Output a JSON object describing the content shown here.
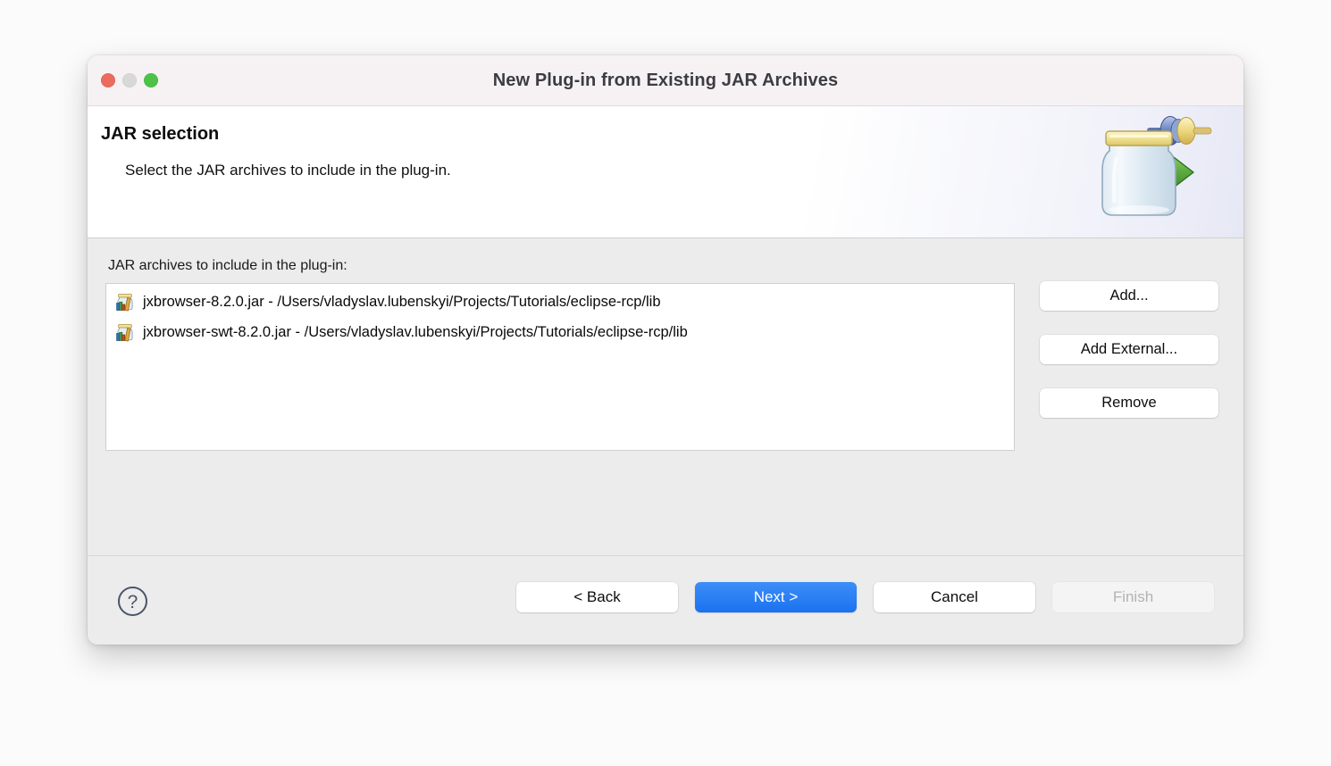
{
  "window": {
    "title": "New Plug-in from Existing JAR Archives",
    "traffic_lights": {
      "close": "close-button",
      "minimize": "minimize-button",
      "maximize": "maximize-button"
    },
    "colors": {
      "close": "#ec6a5e",
      "minimize": "#d8d8d8",
      "maximize": "#4cc247",
      "accent": "#1a72ef",
      "titlebar_bg": "#f6f2f4",
      "dialog_bg": "#ececec"
    }
  },
  "banner": {
    "title": "JAR selection",
    "subtitle": "Select the JAR archives to include in the plug-in.",
    "graphic": "jar-plugin-banner-icon"
  },
  "content": {
    "list_label": "JAR archives to include in the plug-in:",
    "jar_items": [
      {
        "icon": "jar-archive-icon",
        "text": "jxbrowser-8.2.0.jar - /Users/vladyslav.lubenskyi/Projects/Tutorials/eclipse-rcp/lib"
      },
      {
        "icon": "jar-archive-icon",
        "text": "jxbrowser-swt-8.2.0.jar - /Users/vladyslav.lubenskyi/Projects/Tutorials/eclipse-rcp/lib"
      }
    ],
    "side_buttons": [
      {
        "label": "Add...",
        "name": "add-button"
      },
      {
        "label": "Add External...",
        "name": "add-external-button"
      },
      {
        "label": "Remove",
        "name": "remove-button"
      }
    ]
  },
  "footer": {
    "help_icon": "help-icon",
    "buttons": [
      {
        "label": "< Back",
        "state": "enabled"
      },
      {
        "label": "Next >",
        "state": "default"
      },
      {
        "label": "Cancel",
        "state": "enabled"
      },
      {
        "label": "Finish",
        "state": "disabled"
      }
    ]
  }
}
